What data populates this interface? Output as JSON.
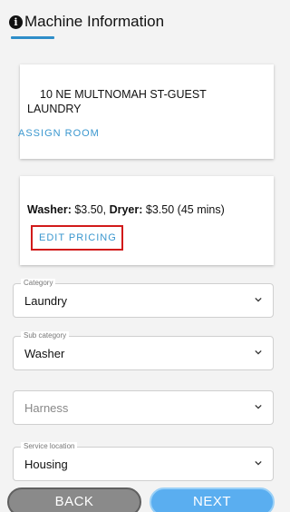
{
  "header": {
    "title": "Machine Information",
    "icon": "info-icon",
    "accent_color": "#2e8ec9"
  },
  "address_card": {
    "address": "10 NE MULTNOMAH ST-GUEST LAUNDRY",
    "assign_room_label": "ASSIGN ROOM"
  },
  "pricing_card": {
    "washer_label": "Washer:",
    "washer_price": "$3.50,",
    "dryer_label": "Dryer:",
    "dryer_price": "$3.50 (45 mins)",
    "edit_pricing_label": "EDIT PRICING",
    "highlight_color": "#d11a1a"
  },
  "fields": {
    "category": {
      "label": "Category",
      "value": "Laundry"
    },
    "sub_category": {
      "label": "Sub category",
      "value": "Washer"
    },
    "harness": {
      "placeholder": "Harness"
    },
    "service_location": {
      "label": "Service location",
      "value": "Housing"
    }
  },
  "buttons": {
    "back_label": "BACK",
    "next_label": "NEXT"
  }
}
